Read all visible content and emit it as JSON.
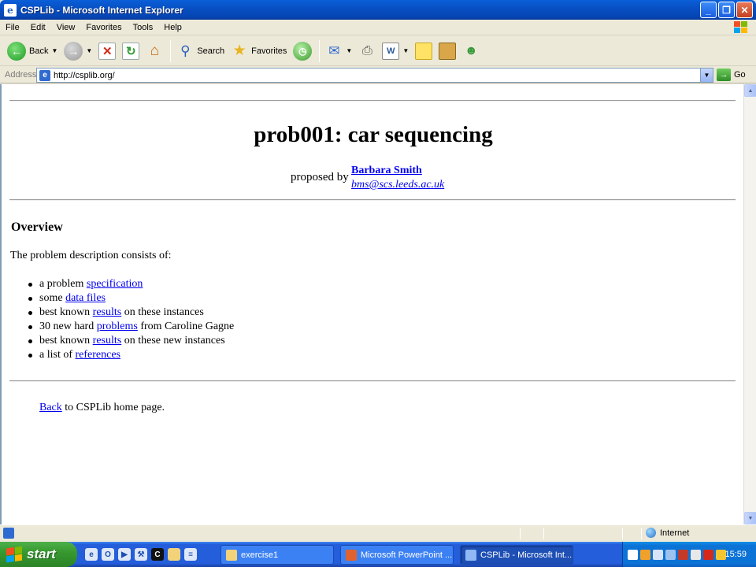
{
  "window": {
    "title": "CSPLib - Microsoft Internet Explorer"
  },
  "menu": [
    "File",
    "Edit",
    "View",
    "Favorites",
    "Tools",
    "Help"
  ],
  "toolbar": {
    "back_label": "Back",
    "search_label": "Search",
    "favorites_label": "Favorites"
  },
  "address": {
    "label": "Address",
    "url": "http://csplib.org/",
    "go_label": "Go"
  },
  "page": {
    "title": "prob001: car sequencing",
    "proposed_by": "proposed by",
    "proposer_name": "Barbara Smith",
    "proposer_email": "bms@scs.leeds.ac.uk",
    "overview_heading": "Overview",
    "intro": "The problem description consists of:",
    "items": [
      {
        "before": "a problem ",
        "link": "specification",
        "after": ""
      },
      {
        "before": "some ",
        "link": "data files",
        "after": ""
      },
      {
        "before": "best known ",
        "link": "results",
        "after": " on these instances"
      },
      {
        "before": "30 new hard ",
        "link": "problems",
        "after": " from Caroline Gagne"
      },
      {
        "before": "best known ",
        "link": "results",
        "after": " on these new instances"
      },
      {
        "before": "a list of ",
        "link": "references",
        "after": ""
      }
    ],
    "back_link": "Back",
    "back_text": " to CSPLib home page."
  },
  "status": {
    "zone": "Internet"
  },
  "taskbar": {
    "start_label": "start",
    "tasks": [
      {
        "label": "exercise1",
        "icon_color": "#f2d37a"
      },
      {
        "label": "Microsoft PowerPoint ...",
        "icon_color": "#e0632f"
      },
      {
        "label": "CSPLib - Microsoft Int...",
        "icon_color": "#8fb8f5"
      }
    ],
    "clock": "15:59"
  }
}
